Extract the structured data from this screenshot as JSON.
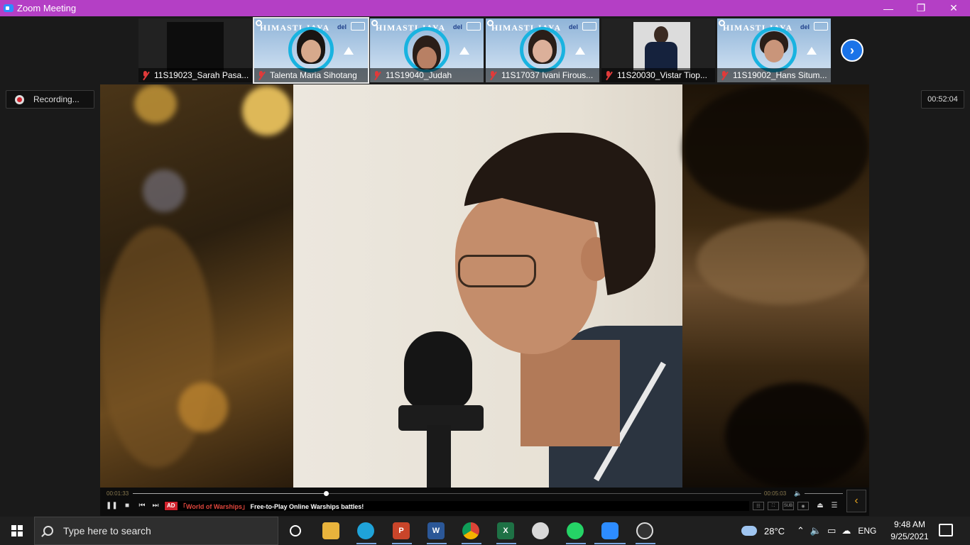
{
  "window": {
    "title": "Zoom Meeting",
    "minimize_icon": "minimize-icon",
    "maximize_icon": "restore-icon",
    "close_icon": "close-icon",
    "titlebar_color": "#b43fc5"
  },
  "participants": [
    {
      "name": "11S19023_Sarah Pasa...",
      "muted": true,
      "video": "off"
    },
    {
      "name": "Talenta Maria Sihotang",
      "muted": true,
      "video": "himasti",
      "active": true
    },
    {
      "name": "11S19040_Judah",
      "muted": true,
      "video": "himasti"
    },
    {
      "name": "11S17037 Ivani Firous...",
      "muted": true,
      "video": "himasti"
    },
    {
      "name": "11S20030_Vistar Tiop...",
      "muted": true,
      "video": "photo"
    },
    {
      "name": "11S19002_Hans Situm...",
      "muted": true,
      "video": "himasti"
    }
  ],
  "virtual_bg": {
    "text": "HIMASTI JAYA",
    "logo": "del"
  },
  "recording": {
    "label": "Recording..."
  },
  "meeting_timer": "00:52:04",
  "player": {
    "elapsed": "00:01:33",
    "duration": "00:05:03",
    "progress": 0.307,
    "ad_tag": "AD",
    "ad_brand": "「World of Warships」",
    "ad_text": "Free-to-Play Online Warships battles!",
    "collapse_icon": "chevron-left-icon"
  },
  "taskbar": {
    "search_placeholder": "Type here to search",
    "apps": [
      "task-view",
      "file-explorer",
      "edge",
      "powerpoint",
      "word",
      "chrome",
      "excel",
      "paint",
      "whatsapp",
      "zoom",
      "obs"
    ],
    "weather": "28°C",
    "language": "ENG",
    "time": "9:48 AM",
    "date": "9/25/2021"
  },
  "colors": {
    "accent_blue": "#1a73e8",
    "record_red": "#d0232d",
    "muted_red": "#e03a3a"
  }
}
